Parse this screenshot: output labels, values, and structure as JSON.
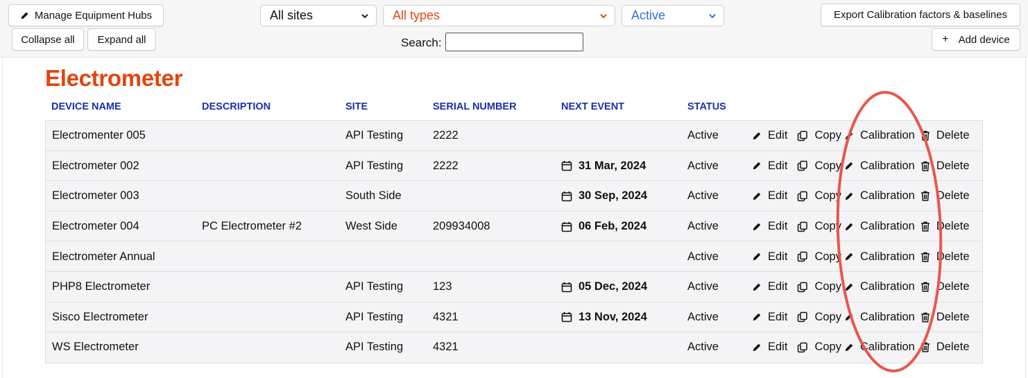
{
  "toolbar": {
    "manage_hubs_label": "Manage Equipment Hubs",
    "collapse_all_label": "Collapse all",
    "expand_all_label": "Expand all",
    "export_label": "Export Calibration factors & baselines",
    "add_device_label": "Add device",
    "search_label": "Search:",
    "search_value": ""
  },
  "filters": {
    "sites": {
      "selected": "All sites",
      "color": "#222222"
    },
    "types": {
      "selected": "All types",
      "color": "#e4440f"
    },
    "status": {
      "selected": "Active",
      "color": "#2f6fe0"
    }
  },
  "section": {
    "title": "Electrometer",
    "color": "#e4440f"
  },
  "columns": {
    "device_name": "DEVICE NAME",
    "description": "DESCRIPTION",
    "site": "SITE",
    "serial_number": "SERIAL NUMBER",
    "next_event": "NEXT EVENT",
    "status": "STATUS"
  },
  "actions": {
    "edit": "Edit",
    "copy": "Copy",
    "calibration": "Calibration",
    "delete": "Delete"
  },
  "icons": {
    "pencil": "pencil-icon",
    "copy": "copy-icon",
    "trash": "trash-icon",
    "calendar": "calendar-icon",
    "plus": "plus-icon",
    "caret": "chevron-down-icon"
  },
  "rows": [
    {
      "name": "Electromenter 005",
      "description": "",
      "site": "API Testing",
      "serial": "2222",
      "next_event": "",
      "status": "Active"
    },
    {
      "name": "Electrometer 002",
      "description": "",
      "site": "API Testing",
      "serial": "2222",
      "next_event": "31 Mar, 2024",
      "status": "Active"
    },
    {
      "name": "Electrometer 003",
      "description": "",
      "site": "South Side",
      "serial": "",
      "next_event": "30 Sep, 2024",
      "status": "Active"
    },
    {
      "name": "Electrometer 004",
      "description": "PC Electrometer #2",
      "site": "West Side",
      "serial": "209934008",
      "next_event": "06 Feb, 2024",
      "status": "Active"
    },
    {
      "name": "Electrometer Annual",
      "description": "",
      "site": "",
      "serial": "",
      "next_event": "",
      "status": "Active"
    },
    {
      "name": "PHP8 Electrometer",
      "description": "",
      "site": "API Testing",
      "serial": "123",
      "next_event": "05 Dec, 2024",
      "status": "Active"
    },
    {
      "name": "Sisco Electrometer",
      "description": "",
      "site": "API Testing",
      "serial": "4321",
      "next_event": "13 Nov, 2024",
      "status": "Active"
    },
    {
      "name": "WS Electrometer",
      "description": "",
      "site": "API Testing",
      "serial": "4321",
      "next_event": "",
      "status": "Active"
    }
  ],
  "annotation": {
    "shape": "ellipse",
    "color": "#e8574a"
  }
}
